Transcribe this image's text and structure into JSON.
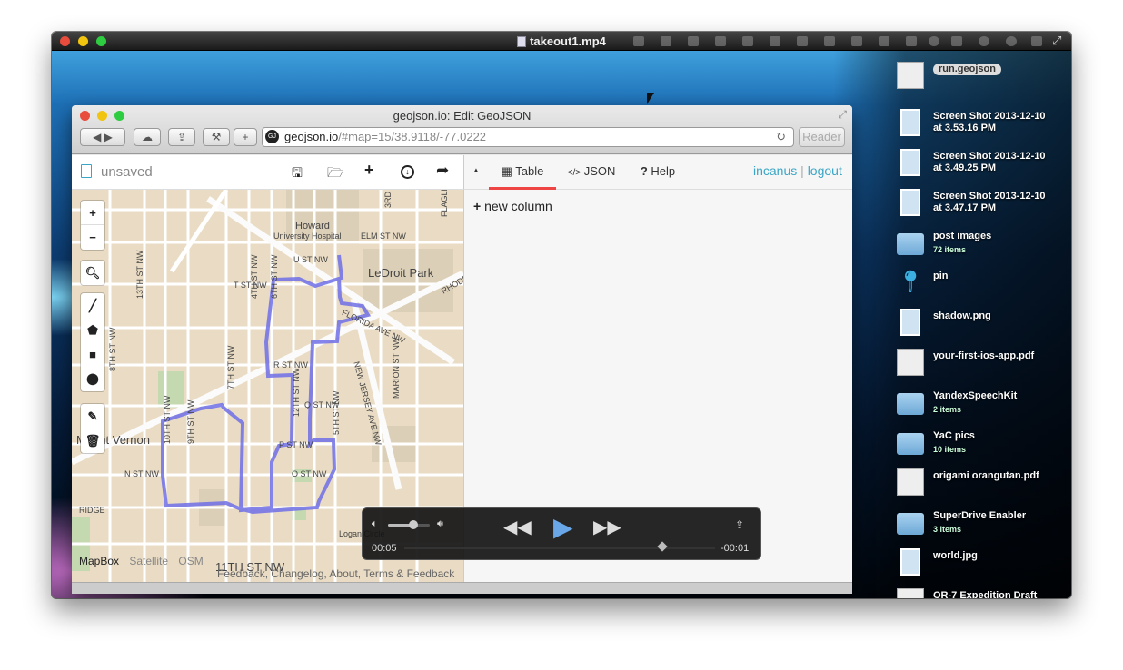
{
  "menubar": {
    "title": "takeout1.mp4"
  },
  "browser": {
    "window_title": "geojson.io: Edit GeoJSON",
    "address_host": "geojson.io",
    "address_path": "/#map=15/38.9118/-77.0222",
    "reader_label": "Reader",
    "reload_glyph": "↻"
  },
  "app": {
    "file_name": "unsaved",
    "tabs": [
      {
        "label": "Table",
        "icon": "table-icon"
      },
      {
        "label": "JSON",
        "icon": "code-icon"
      },
      {
        "label": "Help",
        "icon": "help-icon"
      }
    ],
    "user": "incanus",
    "separator": "|",
    "logout": "logout",
    "new_column": "new column",
    "collapse_glyph": "▲"
  },
  "map": {
    "zoom_in": "+",
    "zoom_out": "−",
    "layers": [
      "MapBox",
      "Satellite",
      "OSM"
    ],
    "attribution": "Feedback, Changelog, About, Terms & Feedback",
    "labels": [
      "Howard",
      "University Hospital",
      "ELM ST NW",
      "U ST NW",
      "LeDroit Park",
      "T ST NW",
      "RHODE",
      "FLORIDA AVE NW",
      "NEW JERSEY AVE NW",
      "R ST NW",
      "Q ST NW",
      "P ST NW",
      "O ST NW",
      "N ST NW",
      "RIDGE",
      "Logan Circle",
      "Mount Vernon",
      "11TH ST NW",
      "10TH ST NW",
      "9TH ST NW",
      "7TH ST NW",
      "6TH ST NW",
      "5TH ST NW",
      "MARION ST NW",
      "12TH ST NW",
      "13TH ST NW",
      "8TH ST NW",
      "4TH ST NW",
      "3RD ST NW",
      "FLAGLER PL NW"
    ]
  },
  "player": {
    "elapsed": "00:05",
    "remaining": "-00:01",
    "progress": 0.83,
    "volume": 0.6
  },
  "desktop": {
    "items": [
      {
        "name": "run.geojson",
        "sub": "",
        "type": "doc",
        "selected": true
      },
      {
        "name": "Screen Shot 2013-12-10",
        "sub": "at 3.53.16 PM",
        "type": "image"
      },
      {
        "name": "Screen Shot 2013-12-10",
        "sub": "at 3.49.25 PM",
        "type": "image"
      },
      {
        "name": "Screen Shot 2013-12-10",
        "sub": "at 3.47.17 PM",
        "type": "image"
      },
      {
        "name": "post images",
        "sub": "72 items",
        "type": "folder"
      },
      {
        "name": "pin",
        "sub": "",
        "type": "pin"
      },
      {
        "name": "shadow.png",
        "sub": "",
        "type": "image"
      },
      {
        "name": "your-first-ios-app.pdf",
        "sub": "",
        "type": "pdf"
      },
      {
        "name": "YandexSpeechKit",
        "sub": "2 items",
        "type": "folder"
      },
      {
        "name": "YaC pics",
        "sub": "10 items",
        "type": "folder"
      },
      {
        "name": "origami orangutan.pdf",
        "sub": "",
        "type": "pdf"
      },
      {
        "name": "SuperDrive Enabler",
        "sub": "3 items",
        "type": "folder"
      },
      {
        "name": "world.jpg",
        "sub": "",
        "type": "image"
      },
      {
        "name": "OR-7 Expedition Draft",
        "sub": "",
        "type": "doc"
      }
    ]
  },
  "colors": {
    "accent_link": "#39a6c6",
    "route": "#6e6ee6",
    "tab_underline": "#e44"
  }
}
